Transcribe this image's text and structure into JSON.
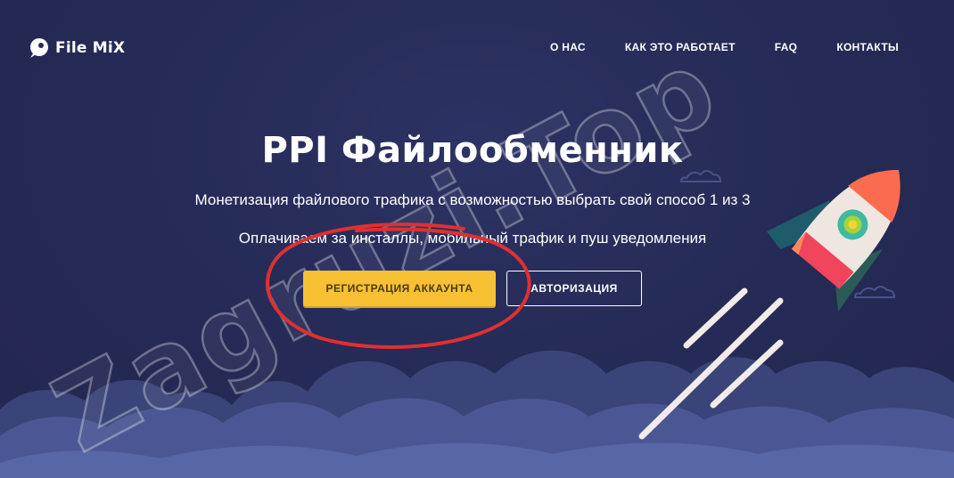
{
  "brand": {
    "name": "File MiX",
    "icon": "rocket-logo-icon"
  },
  "nav": {
    "items": [
      {
        "label": "О НАС"
      },
      {
        "label": "КАК ЭТО РАБОТАЕТ"
      },
      {
        "label": "FAQ"
      },
      {
        "label": "КОНТАКТЫ"
      }
    ]
  },
  "hero": {
    "title": "PPI Файлообменник",
    "subtitle1": "Монетизация файлового трафика с возможностью выбрать свой способ 1 из 3",
    "subtitle2": "Оплачиваем за инсталлы, мобильный трафик и пуш уведомления",
    "register_label": "РЕГИСТРАЦИЯ АККАУНТА",
    "login_label": "АВТОРИЗАЦИЯ"
  },
  "watermark": {
    "text": "Zagruzi.Top"
  },
  "colors": {
    "background": "#252a54",
    "accent": "#f7c133",
    "annotation": "#e0302f"
  }
}
